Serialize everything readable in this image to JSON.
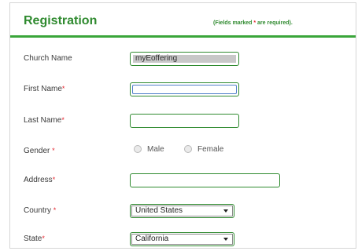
{
  "header": {
    "title": "Registration",
    "required_note_prefix": "(Fields marked ",
    "required_star": "*",
    "required_note_suffix": " are required)."
  },
  "form": {
    "church_name": {
      "label": "Church Name",
      "value": "myEoffering"
    },
    "first_name": {
      "label": "First Name",
      "required": "*",
      "value": ""
    },
    "last_name": {
      "label": "Last Name",
      "required": "*",
      "value": ""
    },
    "gender": {
      "label": "Gender",
      "required": "*",
      "options": [
        "Male",
        "Female"
      ]
    },
    "address": {
      "label": "Address",
      "required": "*",
      "value": ""
    },
    "country": {
      "label": "Country",
      "required": "*",
      "value": "United States"
    },
    "state": {
      "label": "State",
      "required": "*",
      "value": "California"
    }
  },
  "colors": {
    "accent": "#2f8a2f",
    "required_star": "#e3262f",
    "focus_border": "#4f7ec9"
  },
  "icons": {
    "select_arrow": "triangle-down-icon",
    "radio": "radio-circle-icon"
  }
}
